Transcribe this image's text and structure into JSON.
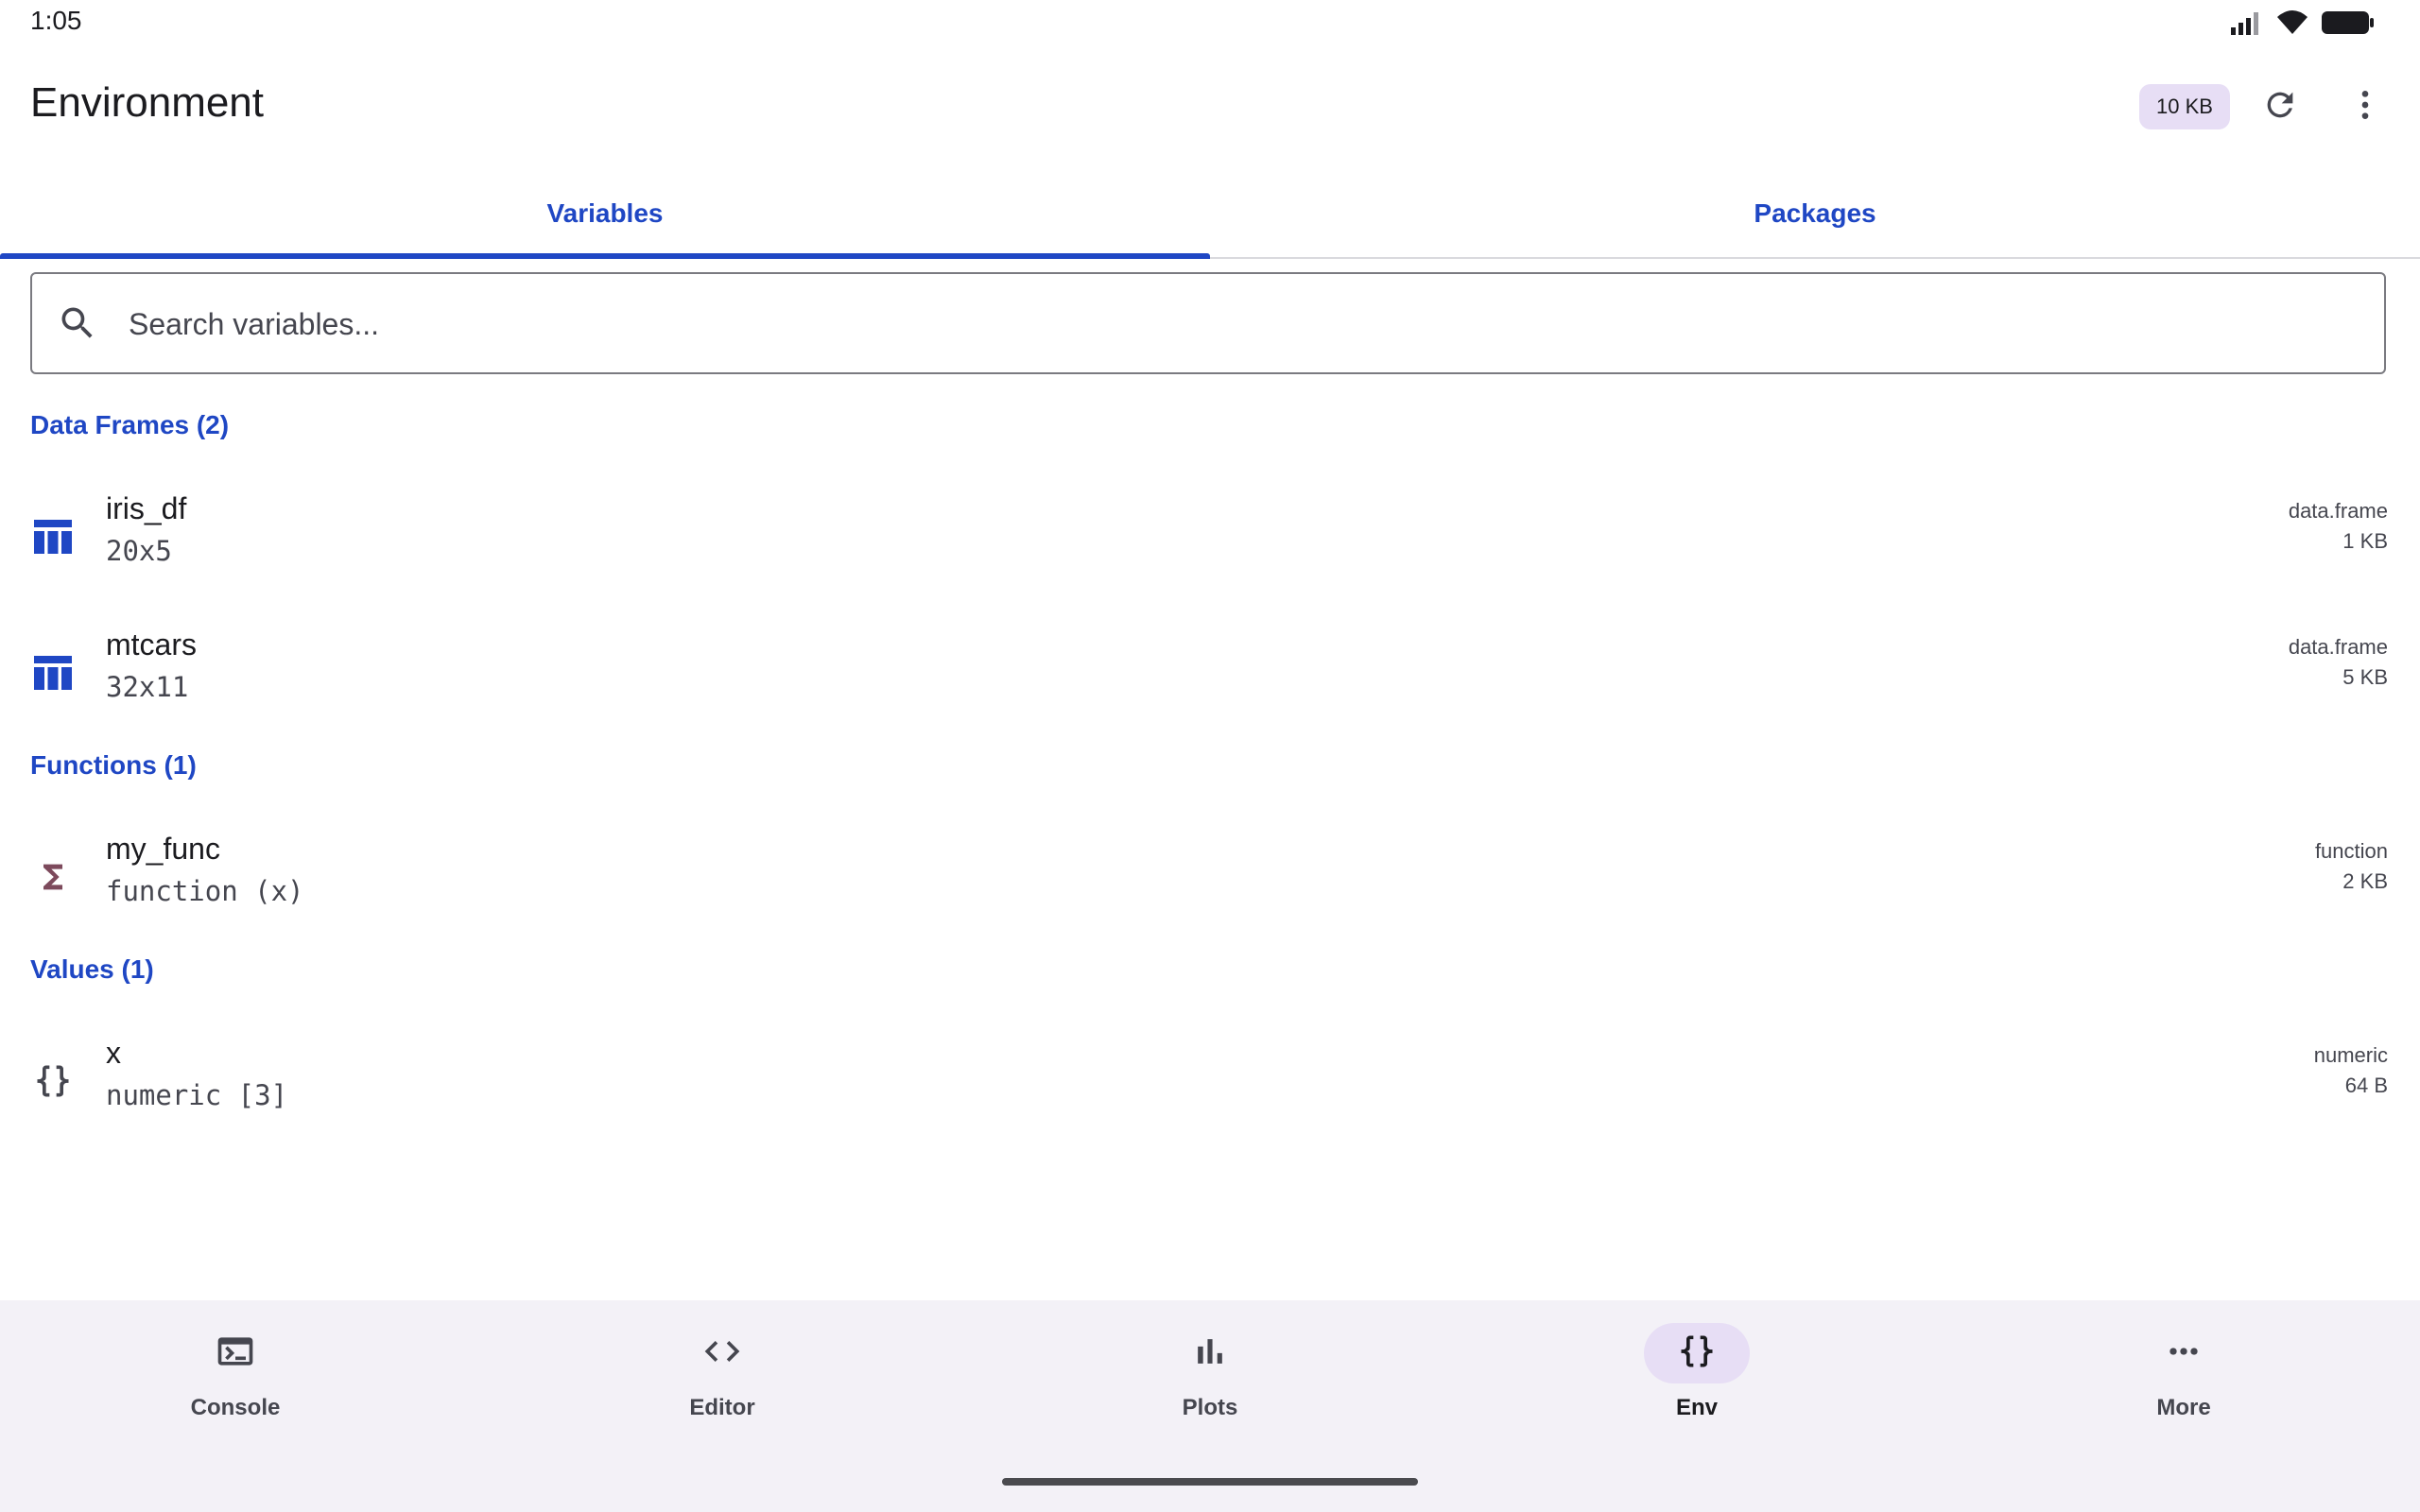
{
  "status": {
    "time": "1:05"
  },
  "app_bar": {
    "title": "Environment",
    "memory_chip": "10 KB"
  },
  "tabs": [
    {
      "label": "Variables",
      "selected": true
    },
    {
      "label": "Packages",
      "selected": false
    }
  ],
  "search": {
    "placeholder": "Search variables...",
    "value": ""
  },
  "sections": {
    "data_frames": {
      "header": "Data Frames (2)",
      "items": [
        {
          "name": "iris_df",
          "summary": "20x5",
          "class": "data.frame",
          "size": "1 KB",
          "icon": "table-icon"
        },
        {
          "name": "mtcars",
          "summary": "32x11",
          "class": "data.frame",
          "size": "5 KB",
          "icon": "table-icon"
        }
      ]
    },
    "functions": {
      "header": "Functions (1)",
      "items": [
        {
          "name": "my_func",
          "summary": "function (x)",
          "class": "function",
          "size": "2 KB",
          "icon": "sigma-icon"
        }
      ]
    },
    "values": {
      "header": "Values (1)",
      "items": [
        {
          "name": "x",
          "summary": "numeric [3]",
          "class": "numeric",
          "size": "64 B",
          "icon": "braces-icon"
        }
      ]
    }
  },
  "nav": [
    {
      "label": "Console",
      "icon": "terminal-icon",
      "active": false
    },
    {
      "label": "Editor",
      "icon": "code-icon",
      "active": false
    },
    {
      "label": "Plots",
      "icon": "bar-chart-icon",
      "active": false
    },
    {
      "label": "Env",
      "icon": "braces-icon",
      "active": true
    },
    {
      "label": "More",
      "icon": "more-horizontal-icon",
      "active": false
    }
  ],
  "colors": {
    "accent": "#1f47c4",
    "chip_bg": "#e7def5",
    "nav_bg": "#f3f1f7",
    "function_icon": "#7d4a5c",
    "muted_text": "#45464f"
  }
}
